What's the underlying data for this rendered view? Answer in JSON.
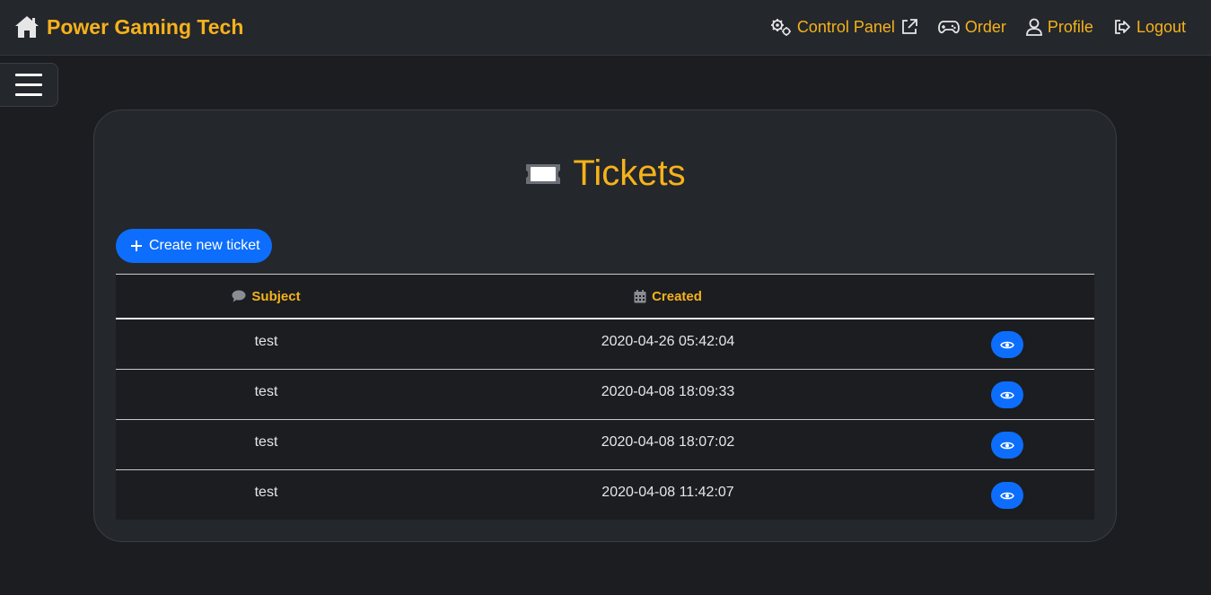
{
  "brand": {
    "name": "Power Gaming Tech",
    "icon": "home-icon"
  },
  "nav": [
    {
      "label": "Control Panel",
      "icon": "gears-icon",
      "trailing_icon": "external-link-icon"
    },
    {
      "label": "Order",
      "icon": "gamepad-icon"
    },
    {
      "label": "Profile",
      "icon": "user-icon"
    },
    {
      "label": "Logout",
      "icon": "logout-icon"
    }
  ],
  "page": {
    "title": "Tickets",
    "title_icon": "ticket-icon",
    "create_button": "Create new ticket"
  },
  "table": {
    "headers": {
      "subject": "Subject",
      "created": "Created"
    },
    "rows": [
      {
        "subject": "test",
        "created": "2020-04-26 05:42:04"
      },
      {
        "subject": "test",
        "created": "2020-04-08 18:09:33"
      },
      {
        "subject": "test",
        "created": "2020-04-08 18:07:02"
      },
      {
        "subject": "test",
        "created": "2020-04-08 11:42:07"
      }
    ]
  },
  "colors": {
    "accent": "#f6b21a",
    "primary": "#0d6efd",
    "background": "#1b1d21",
    "surface": "#24272c"
  }
}
